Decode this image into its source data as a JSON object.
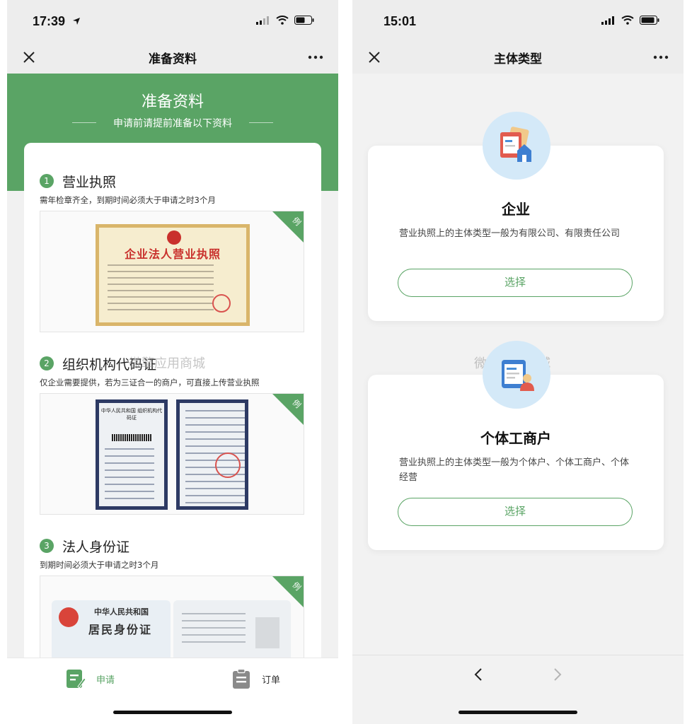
{
  "left": {
    "status_time": "17:39",
    "nav_title": "准备资料",
    "header": {
      "title": "准备资料",
      "subtitle": "申请前请提前准备以下资料"
    },
    "sections": [
      {
        "num": "1",
        "title": "营业执照",
        "desc": "需年检章齐全，到期时间必须大于申请之时3个月",
        "badge": "例",
        "sample_text": "企业法人营业执照"
      },
      {
        "num": "2",
        "title": "组织机构代码证",
        "desc": "仅企业需要提供，若为三证合一的商户，可直接上传营业执照",
        "badge": "例",
        "sample_text": "中华人民共和国 组织机构代码证"
      },
      {
        "num": "3",
        "title": "法人身份证",
        "desc": "到期时间必须大于申请之时3个月",
        "badge": "例",
        "sample_text_1": "中华人民共和国",
        "sample_text_2": "居民身份证"
      }
    ],
    "watermark": "微擎应用商城",
    "tabs": [
      {
        "label": "申请",
        "active": true
      },
      {
        "label": "订单",
        "active": false
      }
    ]
  },
  "right": {
    "status_time": "15:01",
    "nav_title": "主体类型",
    "cards": [
      {
        "title": "企业",
        "desc": "营业执照上的主体类型一般为有限公司、有限责任公司",
        "button": "选择"
      },
      {
        "title": "个体工商户",
        "desc": "营业执照上的主体类型一般为个体户、个体工商户、个体经营",
        "button": "选择"
      }
    ],
    "watermark": "微擎应用商城"
  },
  "colors": {
    "brand_green": "#5aa465",
    "icon_blue": "#d4e9f8"
  },
  "icons": [
    "close-icon",
    "more-icon",
    "signal-icon",
    "wifi-icon",
    "battery-icon",
    "location-arrow-icon",
    "apply-icon",
    "order-icon",
    "back-icon",
    "forward-icon"
  ]
}
